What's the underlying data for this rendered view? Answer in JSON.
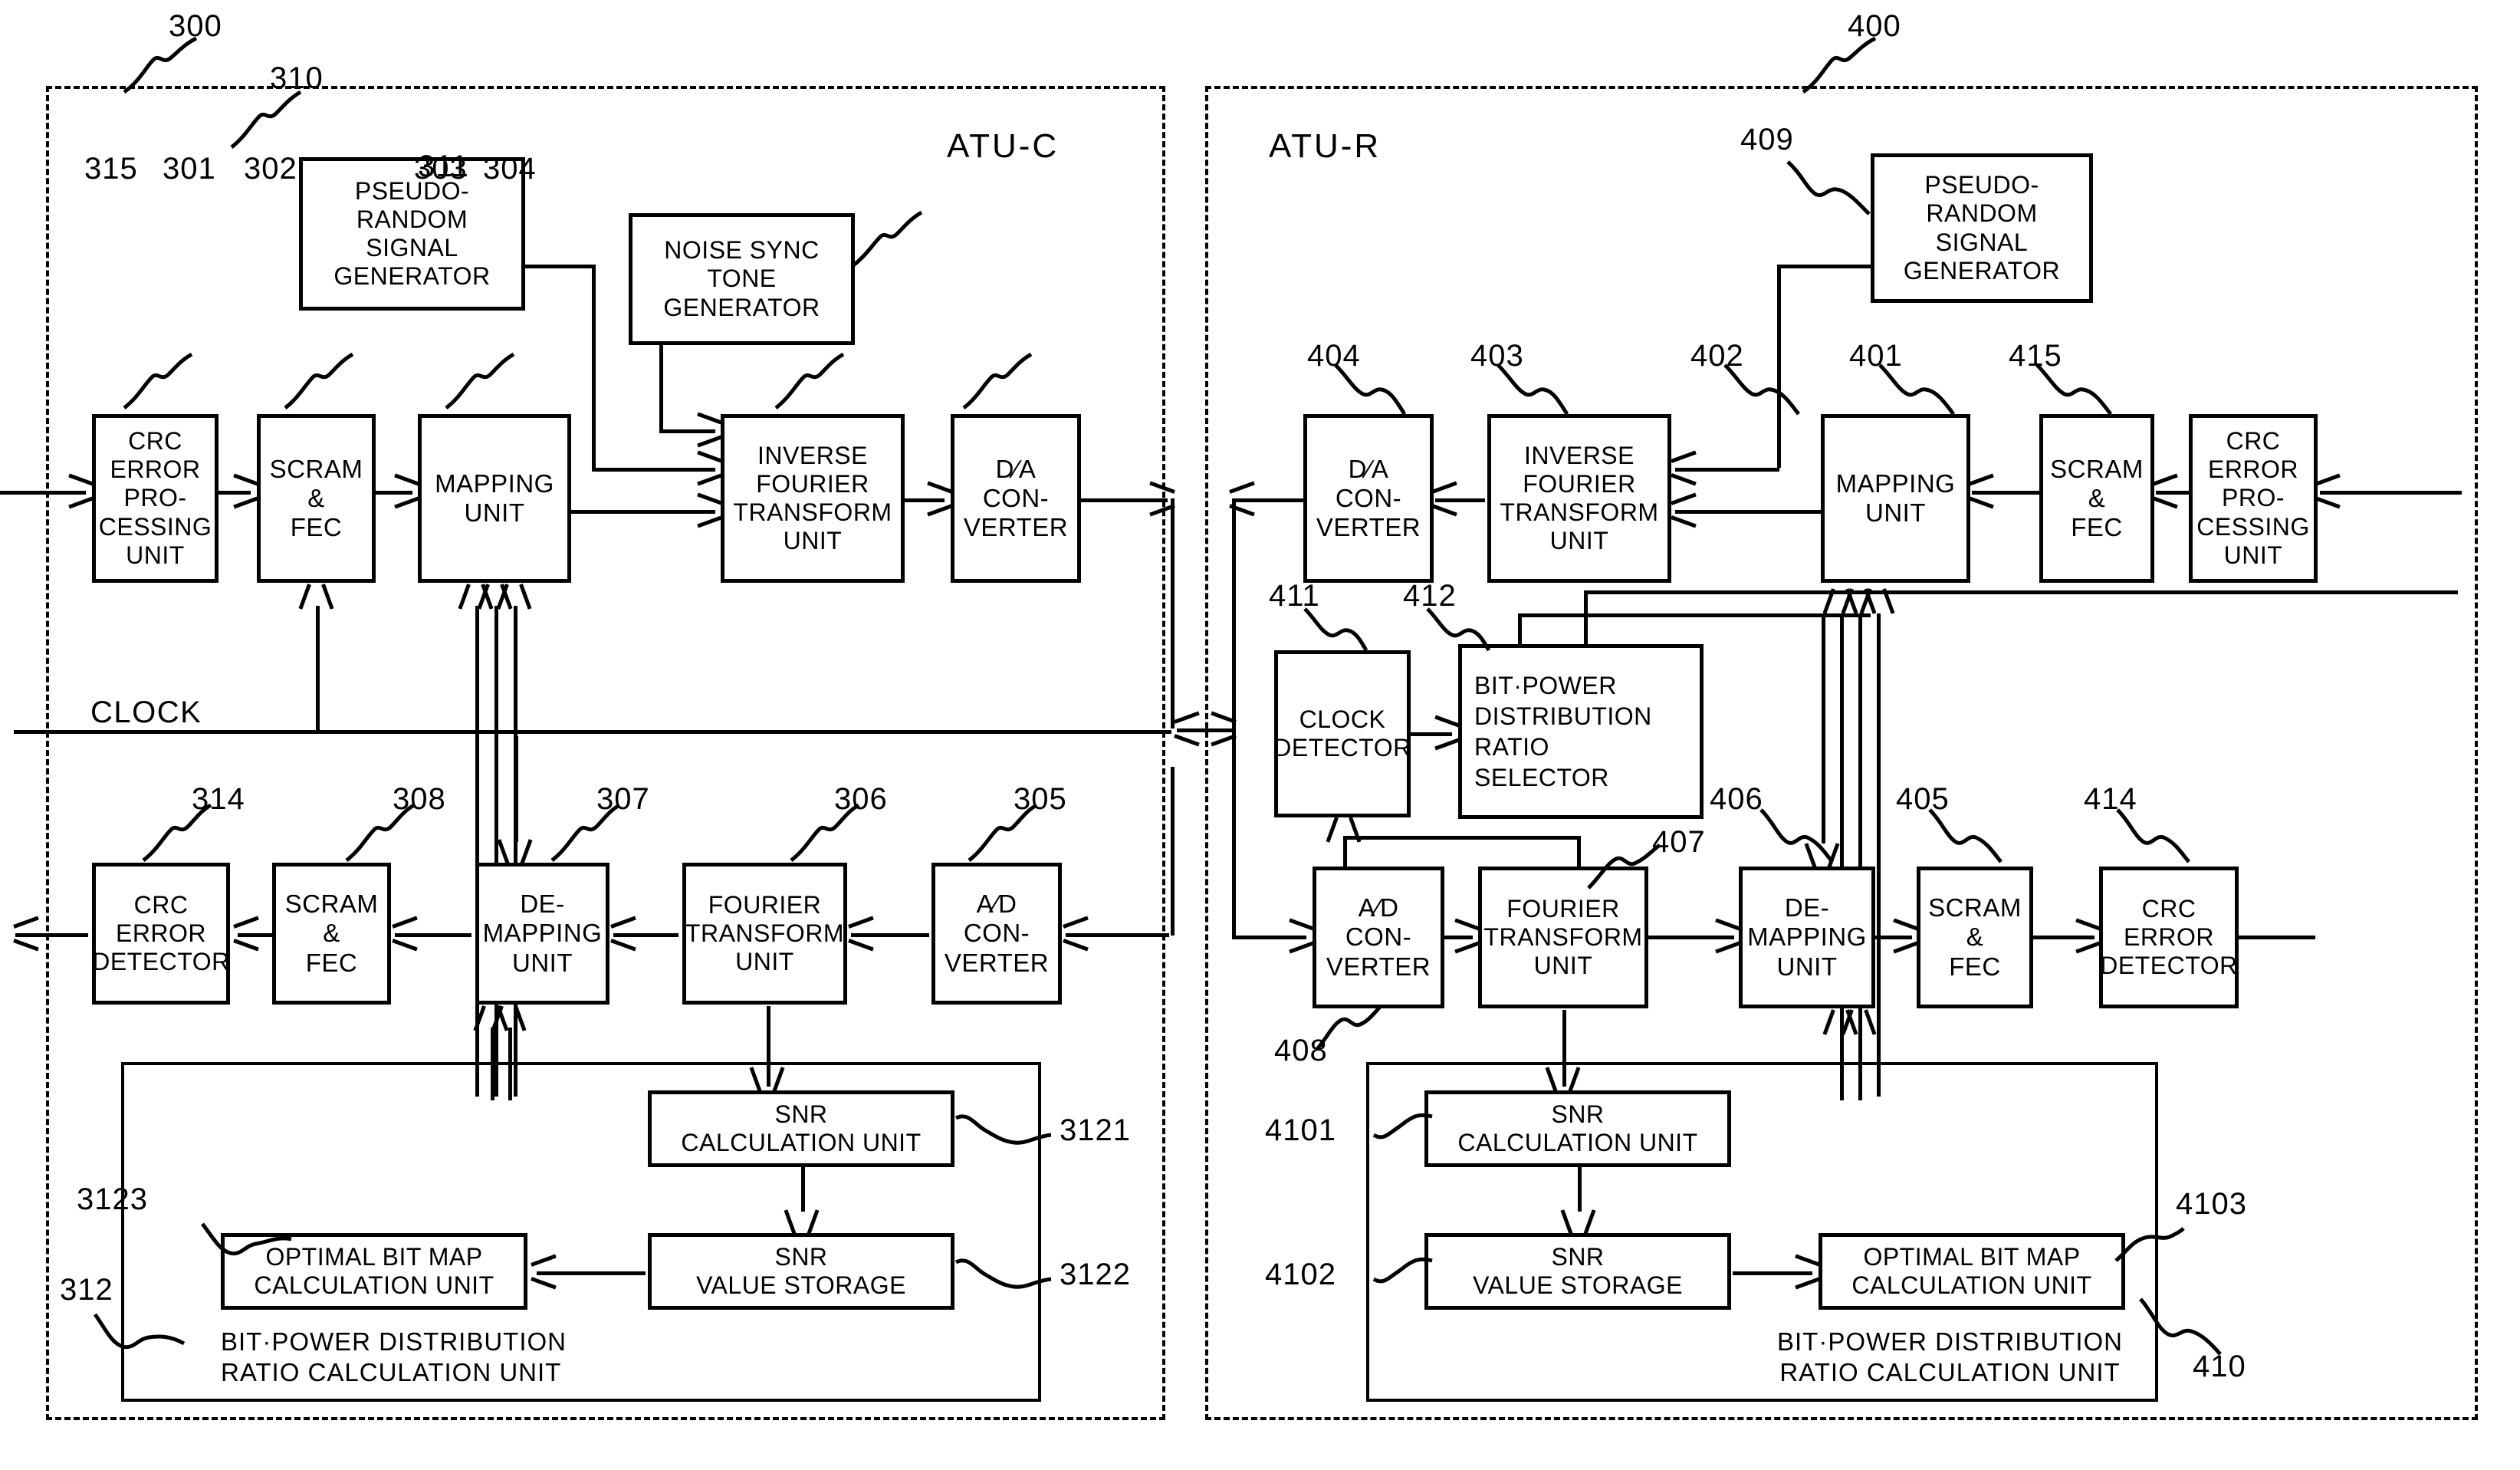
{
  "figure": {
    "left_unit_label": "ATU-C",
    "right_unit_label": "ATU-R",
    "clock_label": "CLOCK"
  },
  "refs": {
    "r300": "300",
    "r400": "400",
    "r310": "310",
    "r311": "311",
    "r315": "315",
    "r301": "301",
    "r302": "302",
    "r303": "303",
    "r304": "304",
    "r314": "314",
    "r308": "308",
    "r307": "307",
    "r306": "306",
    "r305": "305",
    "r312": "312",
    "r3121": "3121",
    "r3122": "3122",
    "r3123": "3123",
    "r409": "409",
    "r404": "404",
    "r403": "403",
    "r402": "402",
    "r401": "401",
    "r415": "415",
    "r411": "411",
    "r412": "412",
    "r408": "408",
    "r407": "407",
    "r406": "406",
    "r405": "405",
    "r414": "414",
    "r410": "410",
    "r4101": "4101",
    "r4102": "4102",
    "r4103": "4103"
  },
  "atu_c": {
    "blocks": {
      "crc_error_processing_unit": "CRC\nERROR\nPRO-\nCESSING\nUNIT",
      "scram_fec_tx": "SCRAM\n&\nFEC",
      "mapping_unit": "MAPPING\nUNIT",
      "pseudo_random_signal_generator": "PSEUDO-\nRANDOM\nSIGNAL\nGENERATOR",
      "noise_sync_tone_generator": "NOISE SYNC\nTONE\nGENERATOR",
      "inverse_fourier_transform_unit": "INVERSE\nFOURIER\nTRANSFORM\nUNIT",
      "da_converter": "D∕A\nCON-\nVERTER",
      "crc_error_detector": "CRC\nERROR\nDETECTOR",
      "scram_fec_rx": "SCRAM\n&\nFEC",
      "de_mapping_unit": "DE-\nMAPPING\nUNIT",
      "fourier_transform_unit": "FOURIER\nTRANSFORM\nUNIT",
      "ad_converter": "A∕D\nCON-\nVERTER",
      "snr_calculation_unit": "SNR\nCALCULATION UNIT",
      "snr_value_storage": "SNR\nVALUE STORAGE",
      "optimal_bit_map_calculation_unit": "OPTIMAL BIT MAP\nCALCULATION UNIT",
      "bit_power_distribution_ratio_calculation_unit": "BIT·POWER DISTRIBUTION\nRATIO CALCULATION UNIT"
    }
  },
  "atu_r": {
    "blocks": {
      "crc_error_processing_unit": "CRC\nERROR\nPRO-\nCESSING\nUNIT",
      "scram_fec_tx": "SCRAM\n&\nFEC",
      "mapping_unit": "MAPPING\nUNIT",
      "pseudo_random_signal_generator": "PSEUDO-\nRANDOM\nSIGNAL\nGENERATOR",
      "inverse_fourier_transform_unit": "INVERSE\nFOURIER\nTRANSFORM\nUNIT",
      "da_converter": "D∕A\nCON-\nVERTER",
      "clock_detector": "CLOCK\nDETECTOR",
      "bit_power_distribution_ratio_selector": "BIT·POWER\nDISTRIBUTION\nRATIO\nSELECTOR",
      "ad_converter": "A∕D\nCON-\nVERTER",
      "fourier_transform_unit": "FOURIER\nTRANSFORM\nUNIT",
      "de_mapping_unit": "DE-\nMAPPING\nUNIT",
      "scram_fec_rx": "SCRAM\n&\nFEC",
      "crc_error_detector": "CRC\nERROR\nDETECTOR",
      "snr_calculation_unit": "SNR\nCALCULATION UNIT",
      "snr_value_storage": "SNR\nVALUE STORAGE",
      "optimal_bit_map_calculation_unit": "OPTIMAL BIT MAP\nCALCULATION UNIT",
      "bit_power_distribution_ratio_calculation_unit": "BIT·POWER DISTRIBUTION\nRATIO CALCULATION UNIT"
    }
  },
  "colors": {
    "ink": "#000000",
    "paper": "#ffffff"
  }
}
